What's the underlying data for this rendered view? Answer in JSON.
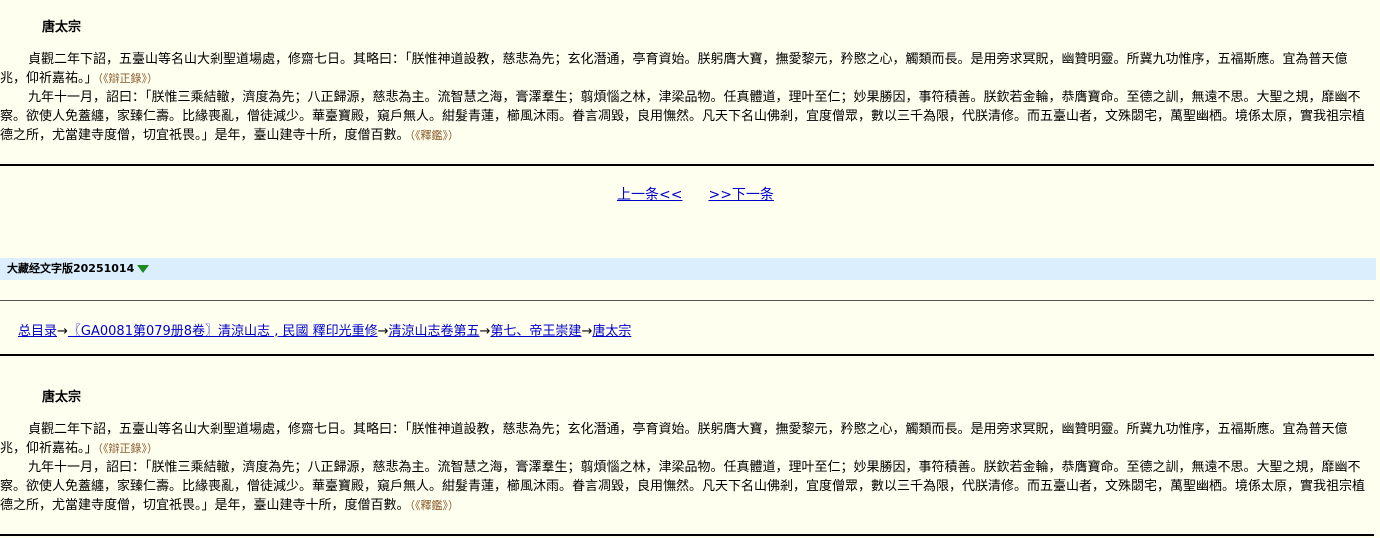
{
  "article": {
    "title": "唐太宗",
    "para1": "貞觀二年下詔，五臺山等名山大剎聖道場處，修齋七日。其略曰：「朕惟神道設教，慈悲為先；玄化潛通，亭育資始。朕躬膺大寶，撫愛黎元，矜愍之心，觸類而長。是用旁求冥貺，幽贊明靈。所冀九功惟序，五福斯應。宜為普天億兆，仰祈嘉祐。」",
    "para1_src": "（《辯正錄》）",
    "para2": "九年十一月，詔曰：「朕惟三乘結轍，濟度為先；八正歸源，慈悲為主。流智慧之海，膏澤羣生；翦煩惱之林，津梁品物。任真體道，理叶至仁；妙果勝因，事符積善。朕欽若金輪，恭膺寶命。至德之訓，無遠不思。大聖之規，靡幽不察。欲使人免蓋纏，家臻仁壽。比緣喪亂，僧徒減少。華臺寶殿，窺戶無人。紺髮青蓮，櫛風沐雨。眷言凋毀，良用憮然。凡天下名山佛剎，宜度僧眾，數以三千為限，代朕清修。而五臺山者，文殊閟宅，萬聖幽栖。境係太原，實我祖宗植德之所，尤當建寺度僧，切宜祇畏。」是年，臺山建寺十所，度僧百數。",
    "para2_src": "（《釋鑑》）"
  },
  "nav": {
    "prev": "上一条<<",
    "next": ">>下一条"
  },
  "edition": {
    "label": "大藏经文字版20251014"
  },
  "breadcrumb": {
    "root": "总目录",
    "arrow": "→",
    "book": "〖GA0081第079册8卷〗清涼山志 , 民國 釋印光重修",
    "volume": "清涼山志卷第五",
    "chapter": "第七、帝王崇建",
    "item": "唐太宗"
  },
  "colors": {
    "background": "#fffff0",
    "link": "#0000cc",
    "source": "#8b5a2b",
    "edition_bar": "#daeefe",
    "triangle": "#1e8a1e"
  }
}
